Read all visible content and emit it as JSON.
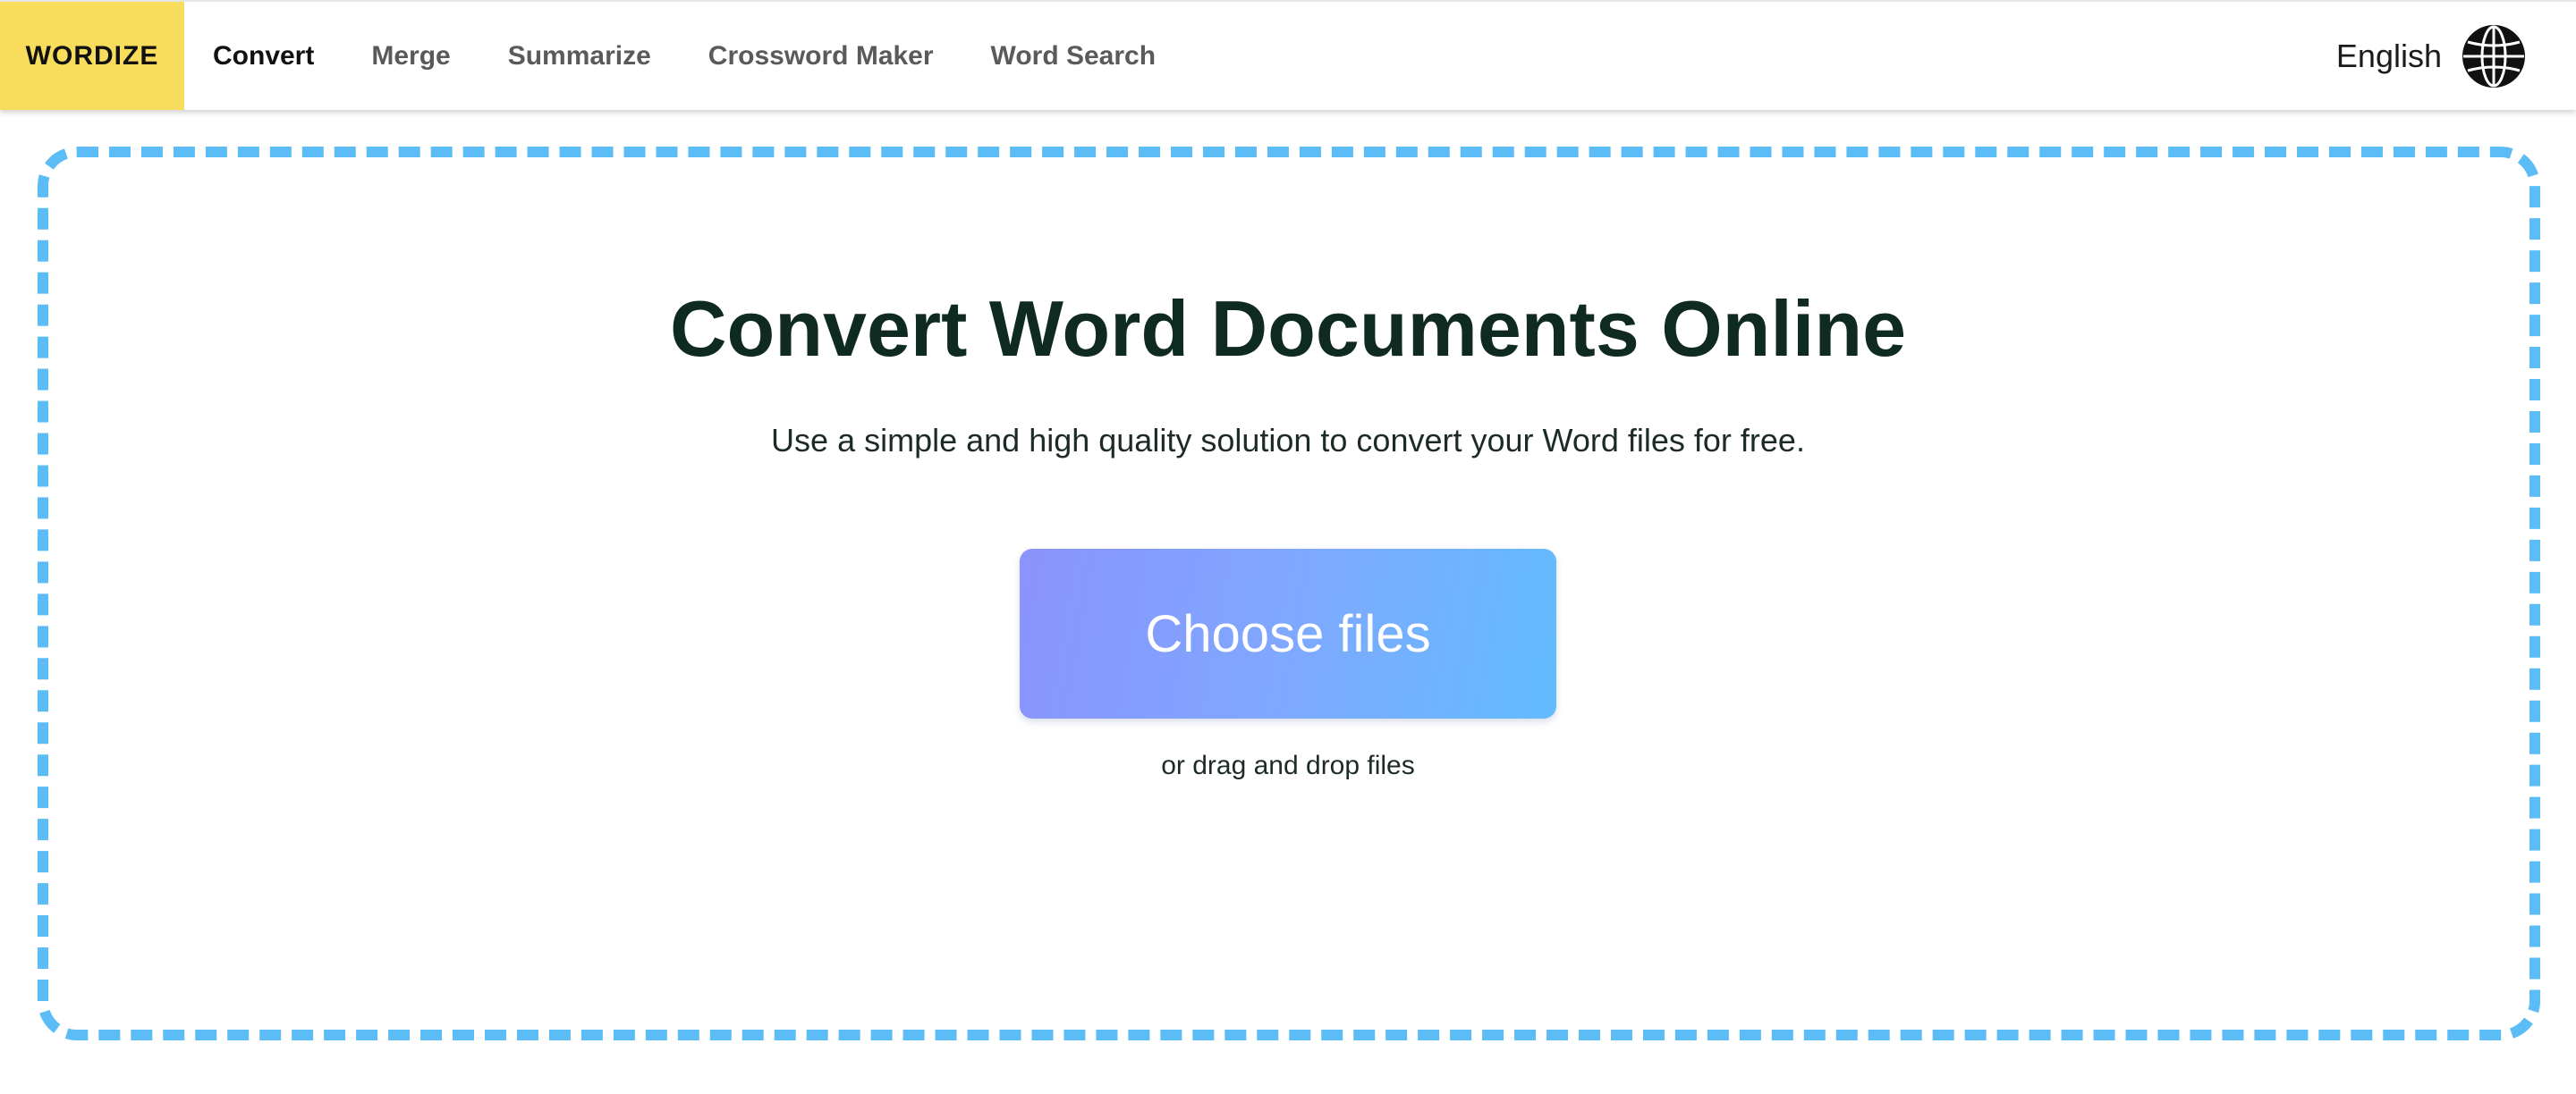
{
  "nav": {
    "brand": "WORDIZE",
    "brand_color": "#f8dd5c",
    "links": [
      {
        "label": "Convert",
        "active": true
      },
      {
        "label": "Merge",
        "active": false
      },
      {
        "label": "Summarize",
        "active": false
      },
      {
        "label": "Crossword Maker",
        "active": false
      },
      {
        "label": "Word Search",
        "active": false
      }
    ],
    "language": "English",
    "language_icon": "globe-icon"
  },
  "main": {
    "title": "Convert Word Documents Online",
    "subtitle": "Use a simple and high quality solution to convert your Word files for free.",
    "choose_label": "Choose files",
    "drag_label": "or drag and drop files"
  },
  "colors": {
    "accent_yellow": "#f8dd5c",
    "dropzone_border": "#5cbcf5",
    "button_gradient_start": "#8a93fb",
    "button_gradient_end": "#62bcfd",
    "title_text": "#0f2a20"
  }
}
